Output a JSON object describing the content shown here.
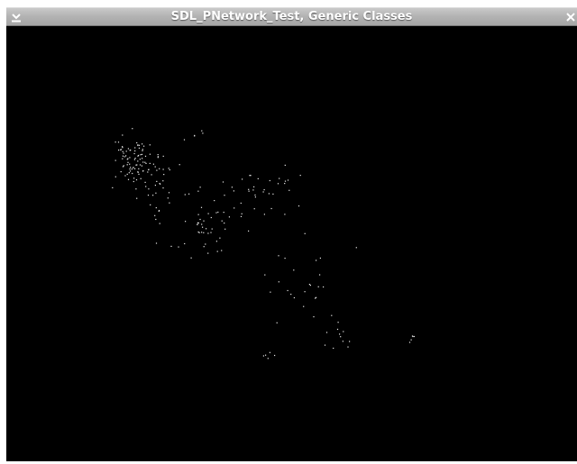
{
  "window": {
    "title": "SDL_PNetwork_Test, Generic Classes",
    "menu_icon": "chevron-down-icon",
    "close_icon": "close-icon"
  },
  "canvas": {
    "background": "#000000",
    "particle_color": "#e8e8e8",
    "particle_count": 260
  }
}
